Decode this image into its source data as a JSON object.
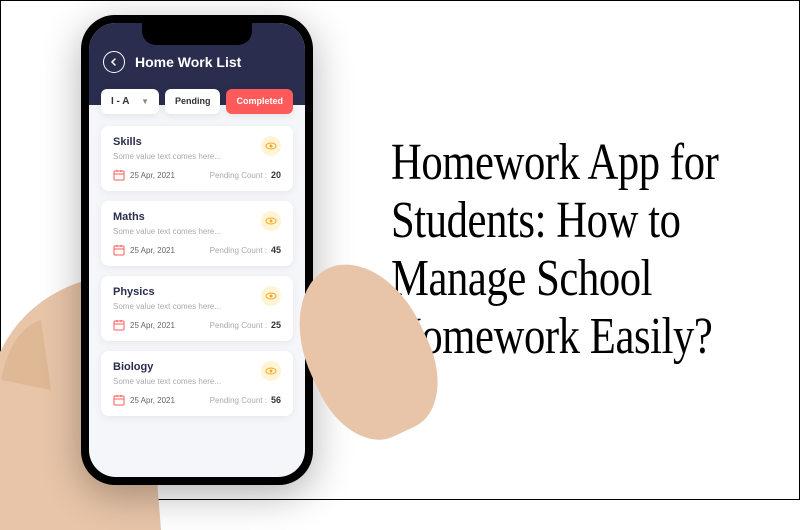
{
  "header": {
    "title": "Home Work List"
  },
  "dropdown": {
    "selected": "I - A"
  },
  "tabs": {
    "pending": "Pending",
    "completed": "Completed"
  },
  "count_label": "Pending Count :",
  "cards": [
    {
      "subject": "Skills",
      "desc": "Some value text comes here...",
      "date": "25 Apr, 2021",
      "count": "20"
    },
    {
      "subject": "Maths",
      "desc": "Some value text comes here...",
      "date": "25 Apr, 2021",
      "count": "45"
    },
    {
      "subject": "Physics",
      "desc": "Some value text comes here...",
      "date": "25 Apr, 2021",
      "count": "25"
    },
    {
      "subject": "Biology",
      "desc": "Some value text comes here...",
      "date": "25 Apr, 2021",
      "count": "56"
    }
  ],
  "headline": "Homework App for Students: How to Manage School Homework Easily?"
}
